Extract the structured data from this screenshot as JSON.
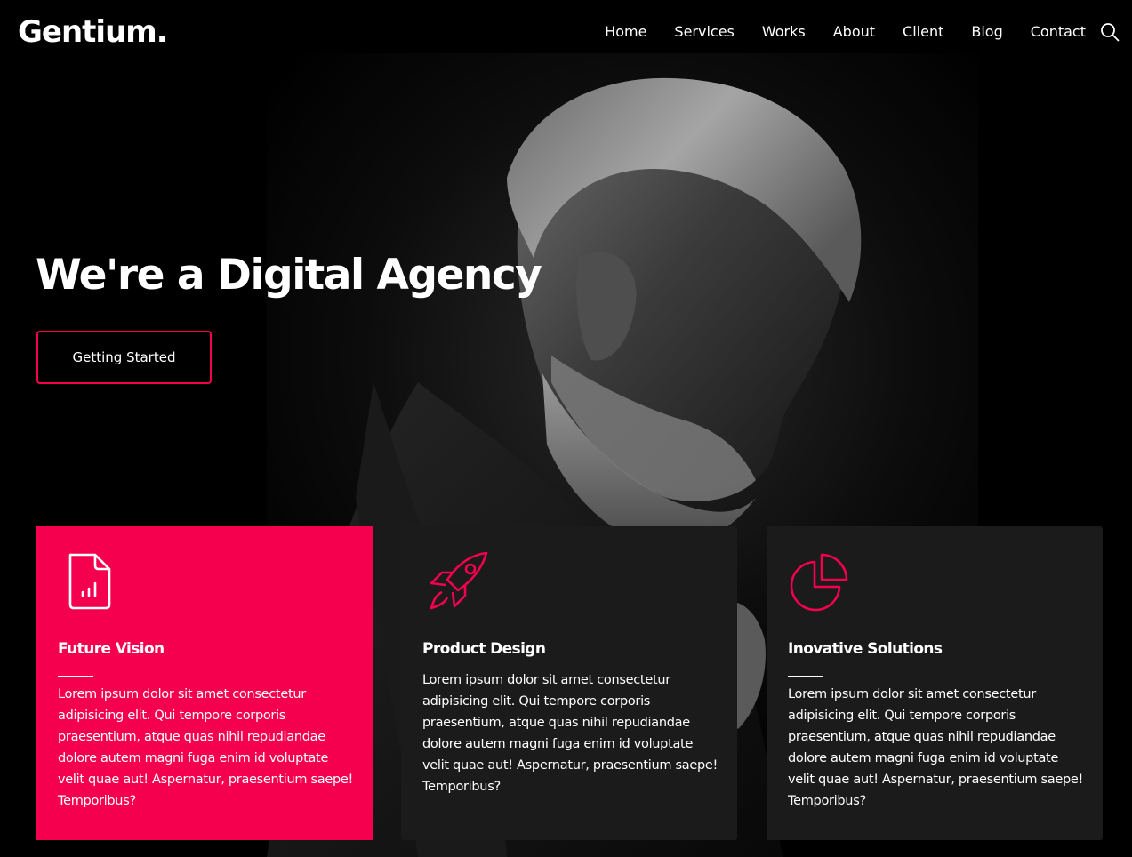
{
  "brand": {
    "logo_text": "Gentium."
  },
  "nav": {
    "items": [
      {
        "label": "Home"
      },
      {
        "label": "Services"
      },
      {
        "label": "Works"
      },
      {
        "label": "About"
      },
      {
        "label": "Client"
      },
      {
        "label": "Blog"
      },
      {
        "label": "Contact"
      }
    ],
    "search_icon": "search-icon"
  },
  "hero": {
    "title": "We're a Digital Agency",
    "cta_label": "Getting Started",
    "image": "portrait-bearded-man-grayscale"
  },
  "features": [
    {
      "icon": "document-chart-icon",
      "title": "Future Vision",
      "text": "Lorem ipsum dolor sit amet consectetur adipisicing elit. Qui tempore corporis praesentium, atque quas nihil repudiandae dolore autem magni fuga enim id voluptate velit quae aut! Aspernatur, praesentium saepe! Temporibus?"
    },
    {
      "icon": "rocket-icon",
      "title": "Product Design",
      "text": "Lorem ipsum dolor sit amet consectetur adipisicing elit. Qui tempore corporis praesentium, atque quas nihil repudiandae dolore autem magni fuga enim id voluptate velit quae aut! Aspernatur, praesentium saepe! Temporibus?"
    },
    {
      "icon": "pie-chart-icon",
      "title": "Inovative Solutions",
      "text": "Lorem ipsum dolor sit amet consectetur adipisicing elit. Qui tempore corporis praesentium, atque quas nihil repudiandae dolore autem magni fuga enim id voluptate velit quae aut! Aspernatur, praesentium saepe! Temporibus?"
    }
  ],
  "colors": {
    "accent": "#f5004f",
    "background": "#000000",
    "card_dark": "#1b1b1c",
    "text": "#ffffff"
  }
}
